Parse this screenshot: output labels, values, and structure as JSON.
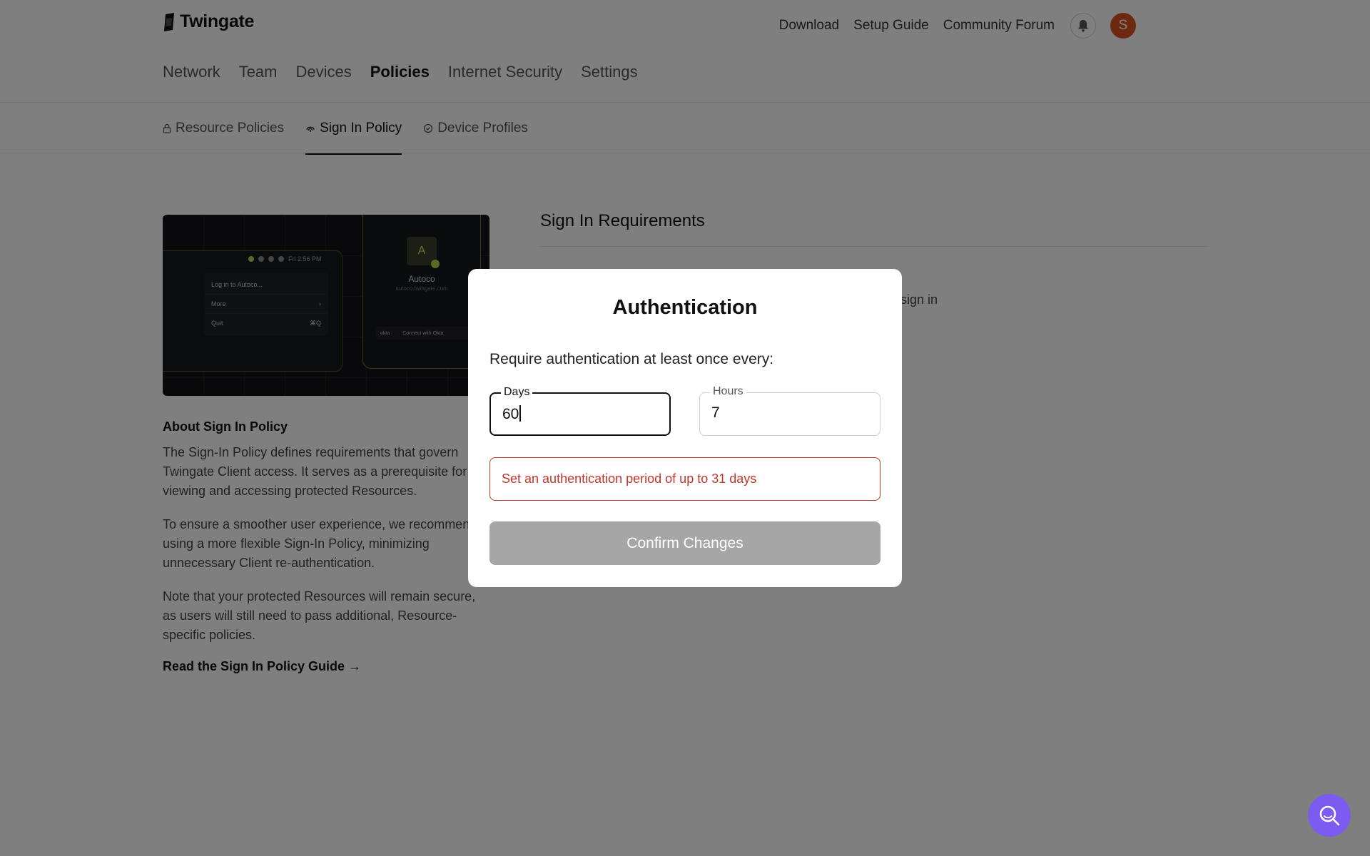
{
  "header": {
    "logo_text": "Twingate",
    "links": [
      "Download",
      "Setup Guide",
      "Community Forum"
    ],
    "avatar_initial": "S"
  },
  "main_nav": {
    "items": [
      "Network",
      "Team",
      "Devices",
      "Policies",
      "Internet Security",
      "Settings"
    ],
    "active": "Policies"
  },
  "sub_nav": {
    "items": [
      {
        "label": "Resource Policies",
        "icon": "lock-icon"
      },
      {
        "label": "Sign In Policy",
        "icon": "fingerprint-icon"
      },
      {
        "label": "Device Profiles",
        "icon": "check-circle-icon"
      }
    ],
    "active": "Sign In Policy"
  },
  "promo": {
    "menu_time": "Fri 2:56 PM",
    "menu_items": [
      {
        "label": "Log in to Autoco...",
        "shortcut": ""
      },
      {
        "label": "More",
        "shortcut": "›"
      },
      {
        "label": "Quit",
        "shortcut": "⌘Q"
      }
    ],
    "app_initial": "A",
    "app_name": "Autoco",
    "app_url": "autoco.twingate.com",
    "app_button_brand": "okta",
    "app_button": "Connect with Okta"
  },
  "about": {
    "title": "About Sign In Policy",
    "p1": "The Sign-In Policy defines requirements that govern Twingate Client access. It serves as a prerequisite for viewing and accessing protected Resources.",
    "p2": "To ensure a smoother user experience, we recommend using a more flexible Sign-In Policy, minimizing unnecessary Client re-authentication.",
    "p3": "Note that your protected Resources will remain secure, as users will still need to pass additional, Resource-specific policies.",
    "guide_link": "Read the Sign In Policy Guide →"
  },
  "requirements": {
    "title": "Sign In Requirements",
    "partial_text": "o sign in"
  },
  "modal": {
    "title": "Authentication",
    "subtitle": "Require authentication at least once every:",
    "days_label": "Days",
    "days_value": "60",
    "hours_label": "Hours",
    "hours_value": "7",
    "error": "Set an authentication period of up to 31 days",
    "confirm_label": "Confirm Changes"
  },
  "colors": {
    "avatar": "#d9531e",
    "error": "#c0362c",
    "help_fab": "#7c5cf0",
    "confirm_disabled": "#a6a6a6"
  }
}
